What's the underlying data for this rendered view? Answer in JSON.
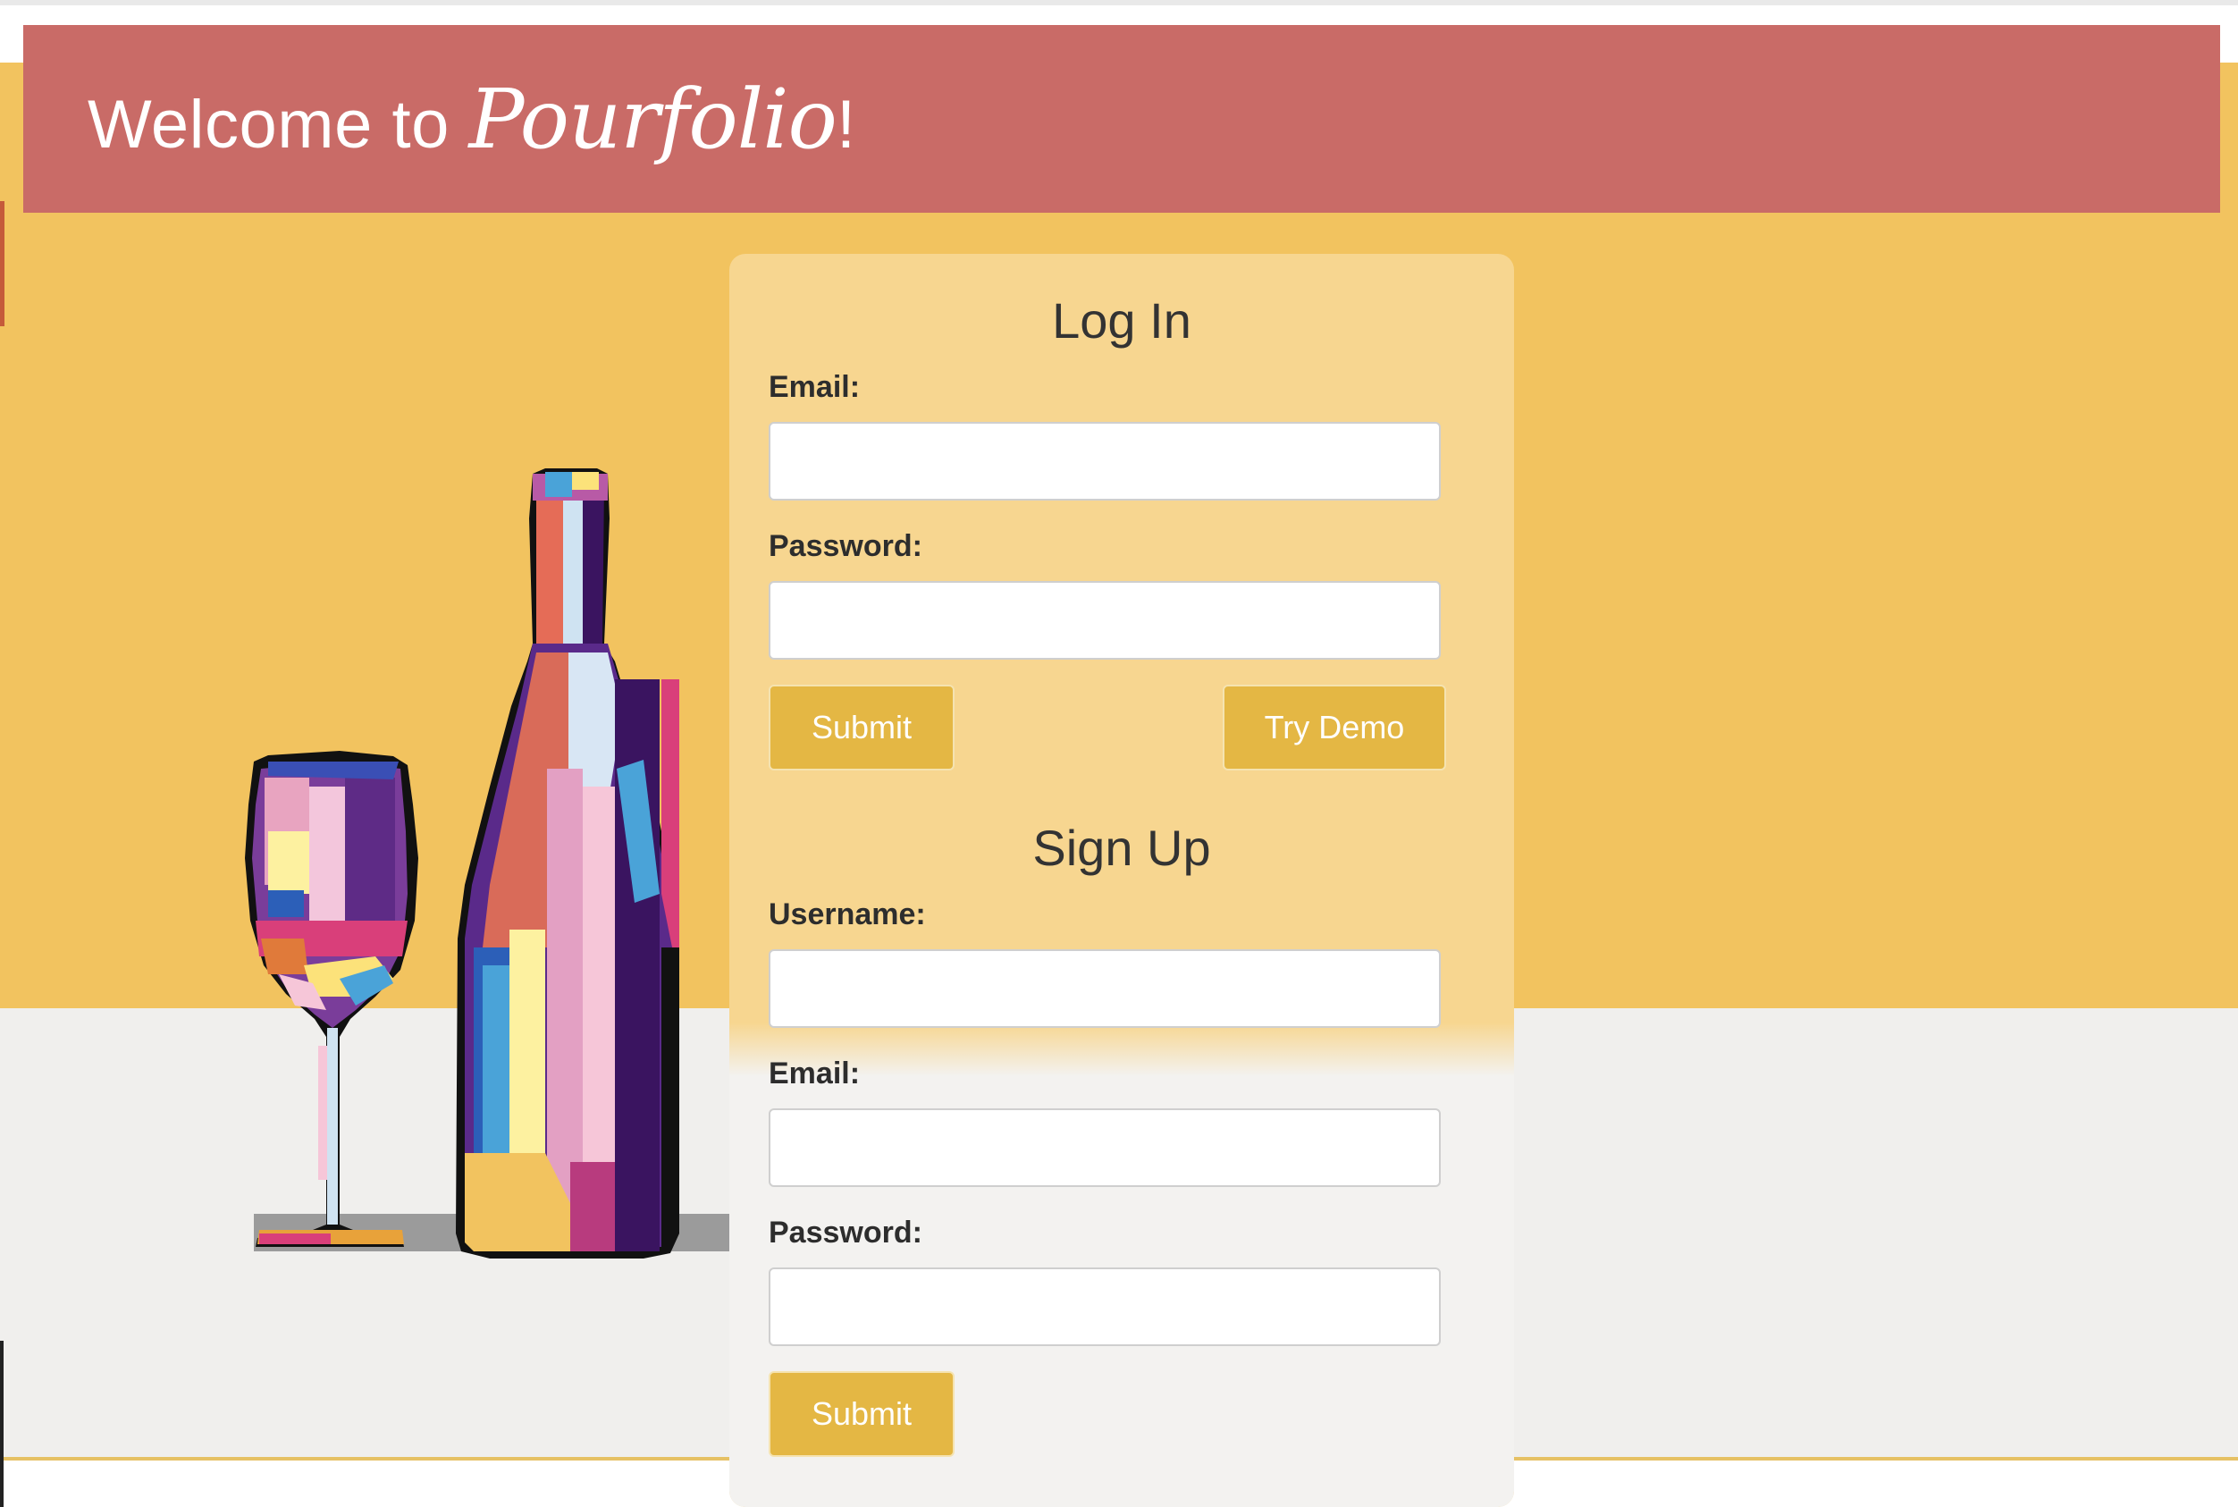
{
  "header": {
    "title_prefix": "Welcome to ",
    "brand": "Pourfolio",
    "title_suffix": "!"
  },
  "login": {
    "title": "Log In",
    "email_label": "Email:",
    "email_value": "",
    "password_label": "Password:",
    "password_value": "",
    "submit_label": "Submit",
    "demo_label": "Try Demo"
  },
  "signup": {
    "title": "Sign Up",
    "username_label": "Username:",
    "username_value": "",
    "email_label": "Email:",
    "email_value": "",
    "password_label": "Password:",
    "password_value": "",
    "submit_label": "Submit"
  },
  "colors": {
    "header_bg": "#c96b67",
    "hero_bg": "#f2c35f",
    "card_bg": "#f7d690",
    "button_bg": "#e4b744",
    "floor_bg": "#f0efed"
  },
  "illustration": {
    "name": "wine-bottle-and-glass-art"
  }
}
